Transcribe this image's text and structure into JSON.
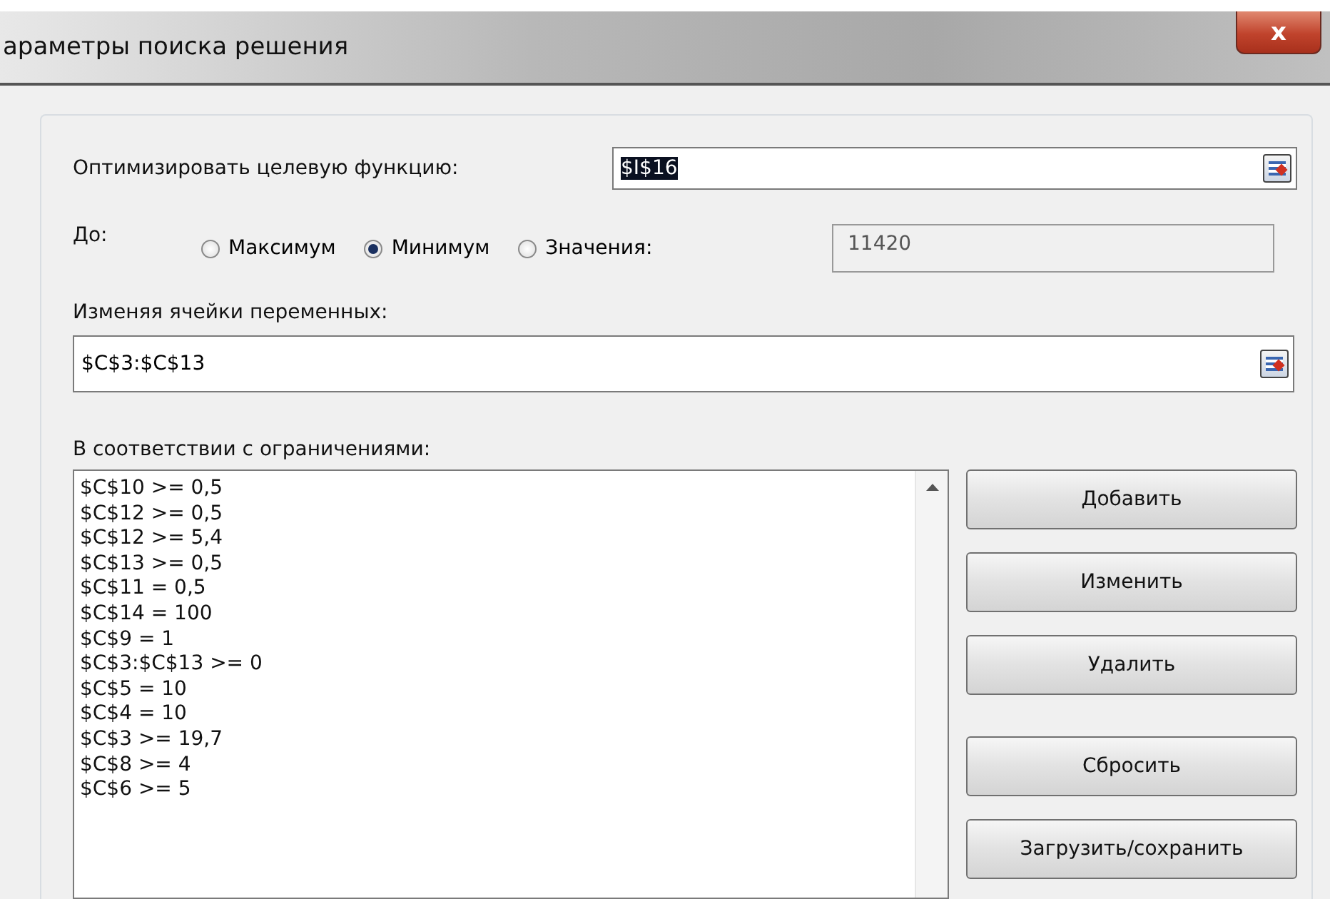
{
  "window": {
    "title": "араметры поиска решения",
    "close": "x"
  },
  "objective": {
    "label": "Оптимизировать целевую функцию:",
    "value": "$I$16",
    "value_selected": true
  },
  "to": {
    "label": "До:",
    "options": [
      {
        "label": "Максимум",
        "selected": false
      },
      {
        "label": "Минимум",
        "selected": true
      },
      {
        "label": "Значения:",
        "selected": false
      }
    ],
    "value": "11420",
    "value_disabled": true
  },
  "variables": {
    "label": "Изменяя ячейки переменных:",
    "value": "$C$3:$C$13"
  },
  "constraints": {
    "label": "В соответствии с ограничениями:",
    "items": [
      "$C$10 >= 0,5",
      "$C$12 >= 0,5",
      "$C$12 >= 5,4",
      "$C$13 >= 0,5",
      "$C$11 = 0,5",
      "$C$14 = 100",
      "$C$9 = 1",
      "$C$3:$C$13 >= 0",
      "$C$5 = 10",
      "$C$4 = 10",
      "$C$3 >= 19,7",
      "$C$8 >= 4",
      "$C$6 >= 5"
    ]
  },
  "button_groups": [
    [
      "Добавить",
      "Изменить",
      "Удалить"
    ],
    [
      "Сбросить",
      "Загрузить/сохранить"
    ]
  ]
}
